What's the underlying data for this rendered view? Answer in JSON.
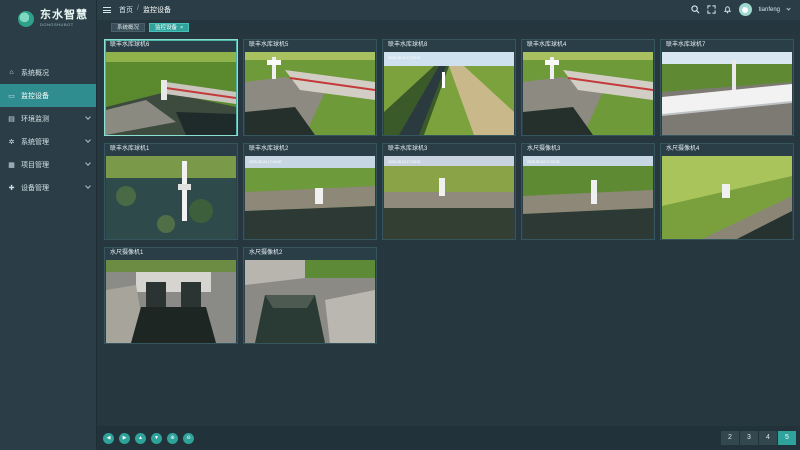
{
  "app": {
    "logo_title": "东水智慧",
    "logo_sub": "DONGSHUBOT"
  },
  "sidebar": {
    "items": [
      {
        "label": "系统概况",
        "icon": "home-icon",
        "active": false,
        "expandable": false
      },
      {
        "label": "监控设备",
        "icon": "monitor-icon",
        "active": true,
        "expandable": false
      },
      {
        "label": "环境监测",
        "icon": "document-icon",
        "active": false,
        "expandable": true
      },
      {
        "label": "系统管理",
        "icon": "gear-icon",
        "active": false,
        "expandable": true
      },
      {
        "label": "项目管理",
        "icon": "grid-icon",
        "active": false,
        "expandable": true
      },
      {
        "label": "设备管理",
        "icon": "device-icon",
        "active": false,
        "expandable": true
      }
    ]
  },
  "header": {
    "breadcrumb": [
      "首页",
      "监控设备"
    ],
    "separator": "/",
    "username": "tianfeng"
  },
  "tags": [
    {
      "label": "系统概况",
      "active": false
    },
    {
      "label": "监控设备",
      "active": true,
      "close": "×"
    }
  ],
  "cameras": [
    {
      "title": "联丰水库球机6",
      "osd": "",
      "scene": "bridge"
    },
    {
      "title": "联丰水库球机5",
      "osd": "",
      "scene": "bridge2"
    },
    {
      "title": "联丰水库球机8",
      "osd": "2025-05-24 17:00:32",
      "scene": "canal"
    },
    {
      "title": "联丰水库球机4",
      "osd": "",
      "scene": "bridge2"
    },
    {
      "title": "联丰水库球机7",
      "osd": "",
      "scene": "pipe"
    },
    {
      "title": "联丰水库球机1",
      "osd": "",
      "scene": "topdown"
    },
    {
      "title": "联丰水库球机2",
      "osd": "2025-05-24 17:00:32",
      "scene": "ditch"
    },
    {
      "title": "联丰水库球机3",
      "osd": "2025-05-24 17:00:32",
      "scene": "ditch"
    },
    {
      "title": "水尺摄像机3",
      "osd": "2025-05-24 17:00:32",
      "scene": "ditch"
    },
    {
      "title": "水尺摄像机4",
      "osd": "",
      "scene": "slope"
    },
    {
      "title": "水尺摄像机1",
      "osd": "",
      "scene": "culvert"
    },
    {
      "title": "水尺摄像机2",
      "osd": "",
      "scene": "culvert2"
    }
  ],
  "footer": {
    "controls": [
      {
        "name": "left-arrow-icon",
        "glyph": "◀"
      },
      {
        "name": "right-arrow-icon",
        "glyph": "▶"
      },
      {
        "name": "up-arrow-icon",
        "glyph": "▲"
      },
      {
        "name": "down-arrow-icon",
        "glyph": "▼"
      },
      {
        "name": "zoom-in-icon",
        "glyph": "⊕"
      },
      {
        "name": "zoom-out-icon",
        "glyph": "⊖"
      }
    ],
    "pages": [
      "2",
      "3",
      "4",
      "5"
    ],
    "active_page": "5"
  },
  "colors": {
    "accent": "#2fa39b",
    "sidebar_bg": "#2b3e47",
    "main_bg": "#263740"
  }
}
